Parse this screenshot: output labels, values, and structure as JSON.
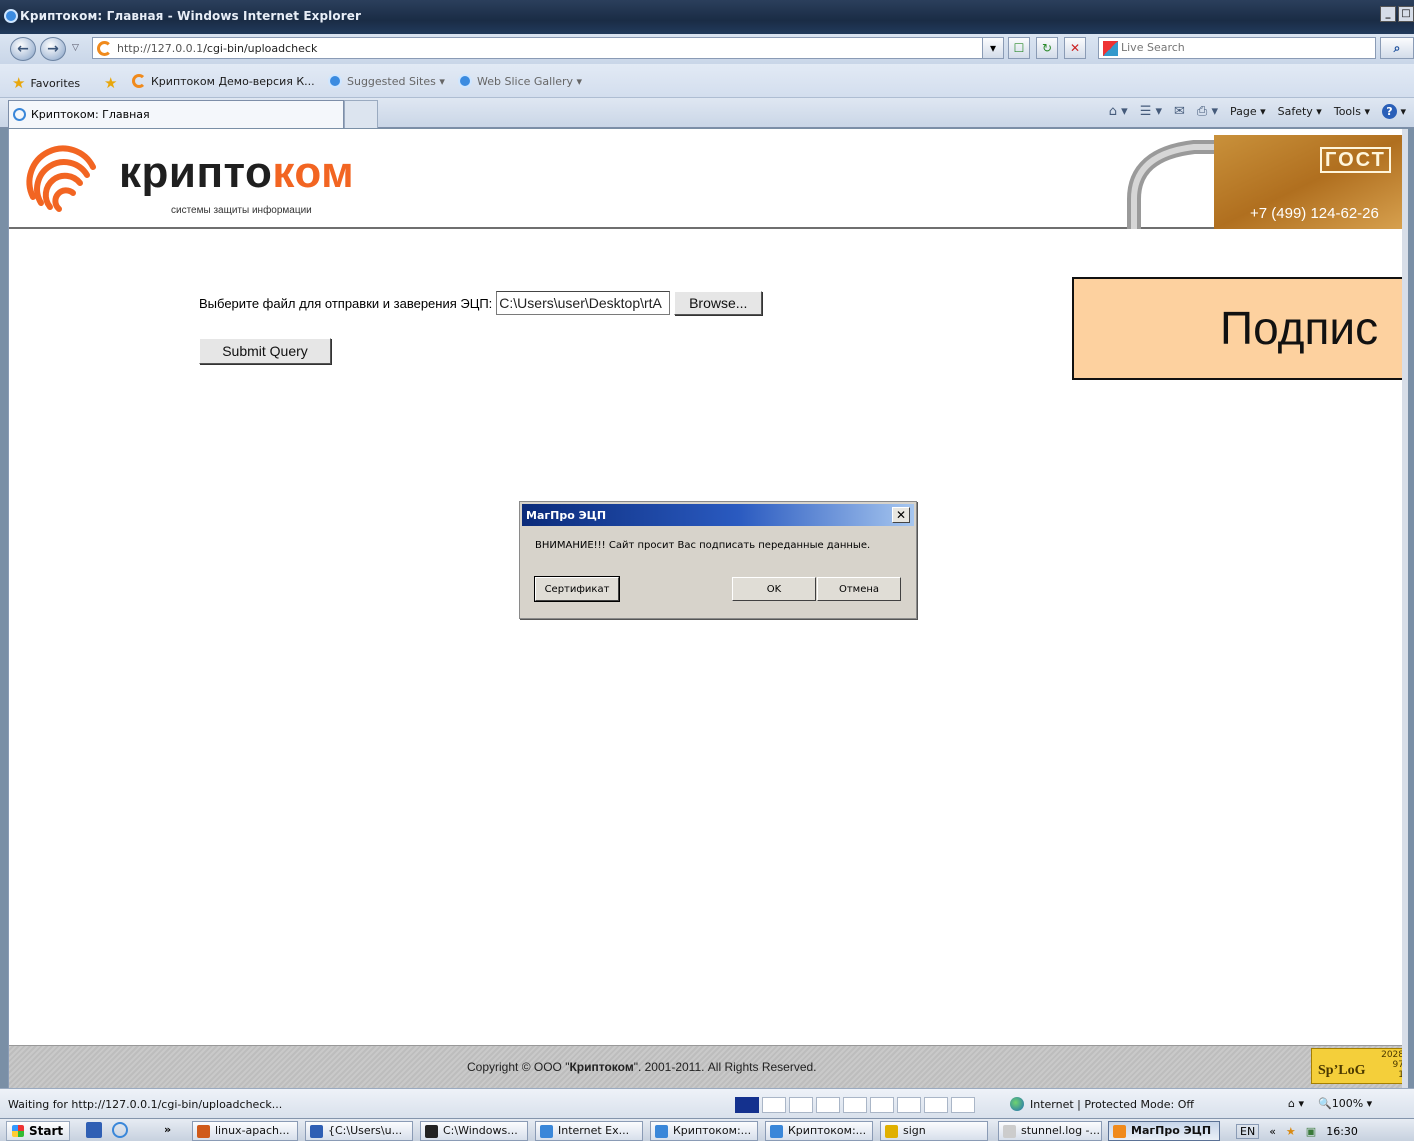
{
  "window": {
    "title": "Криптоком: Главная - Windows Internet Explorer",
    "buttons": [
      "_",
      "□"
    ]
  },
  "addressbar": {
    "url_host": "http://127.0.0.1",
    "url_path": "/cgi-bin/uploadcheck",
    "search_placeholder": "Live Search"
  },
  "favorites": {
    "label": "Favorites",
    "items": [
      {
        "label": "Криптоком Демо-версия К..."
      },
      {
        "label": "Suggested Sites ▾"
      },
      {
        "label": "Web Slice Gallery ▾"
      }
    ]
  },
  "tabs": {
    "active_label": "Криптоком: Главная"
  },
  "commandbar": {
    "page": "Page ▾",
    "safety": "Safety ▾",
    "tools": "Tools ▾"
  },
  "site": {
    "logo_dark": "крипто",
    "logo_accent": "ком",
    "tagline": "системы защиты информации",
    "gost_label": "ГОСТ",
    "phone": "+7 (499) 124-62-26",
    "brand_colors": {
      "accent": "#f26522",
      "sign_box": "#fdd19f"
    }
  },
  "form": {
    "file_label": "Выберите файл для отправки и заверения ЭЦП:",
    "file_value": "C:\\Users\\user\\Desktop\\rtA",
    "browse_label": "Browse...",
    "submit_label": "Submit Query",
    "sign_banner": "Подпис"
  },
  "dialog": {
    "title": "МагПро ЭЦП",
    "close_glyph": "✕",
    "message": "ВНИМАНИЕ!!! Сайт просит Вас подписать переданные данные.",
    "certificate_button": "Сертификат",
    "ok_button": "OK",
    "cancel_button": "Отмена"
  },
  "footer": {
    "copyright_prefix": "Copyright © ООО \"",
    "copyright_company": "Криптоком",
    "copyright_suffix": "\". 2001-2011. All Rights Reserved.",
    "counter_logo": "Sp’LoG",
    "counter_values": [
      "2028",
      "97",
      "1"
    ]
  },
  "statusbar": {
    "text": "Waiting for http://127.0.0.1/cgi-bin/uploadcheck...",
    "zone": "Internet | Protected Mode: Off",
    "zoom": "🔍100%  ▾",
    "progress_fraction": 0.1
  },
  "taskbar": {
    "start_label": "Start",
    "chevron": "»",
    "tasks": [
      {
        "label": "linux-apach...",
        "color": "#d05a1a"
      },
      {
        "label": "{C:\\Users\\u...",
        "color": "#2f5fb4"
      },
      {
        "label": "C:\\Windows...",
        "color": "#222222"
      },
      {
        "label": "Internet Ex...",
        "color": "#3a87d9"
      },
      {
        "label": "Криптоком:...",
        "color": "#3a87d9"
      },
      {
        "label": "Криптоком:...",
        "color": "#3a87d9"
      },
      {
        "label": "sign",
        "color": "#e0b000"
      },
      {
        "label": "stunnel.log -...",
        "color": "#cccccc"
      },
      {
        "label": "МагПро ЭЦП",
        "color": "#f08a1c"
      }
    ],
    "tray_lang": "EN",
    "tray_chevron": "«",
    "clock": "16:30"
  }
}
